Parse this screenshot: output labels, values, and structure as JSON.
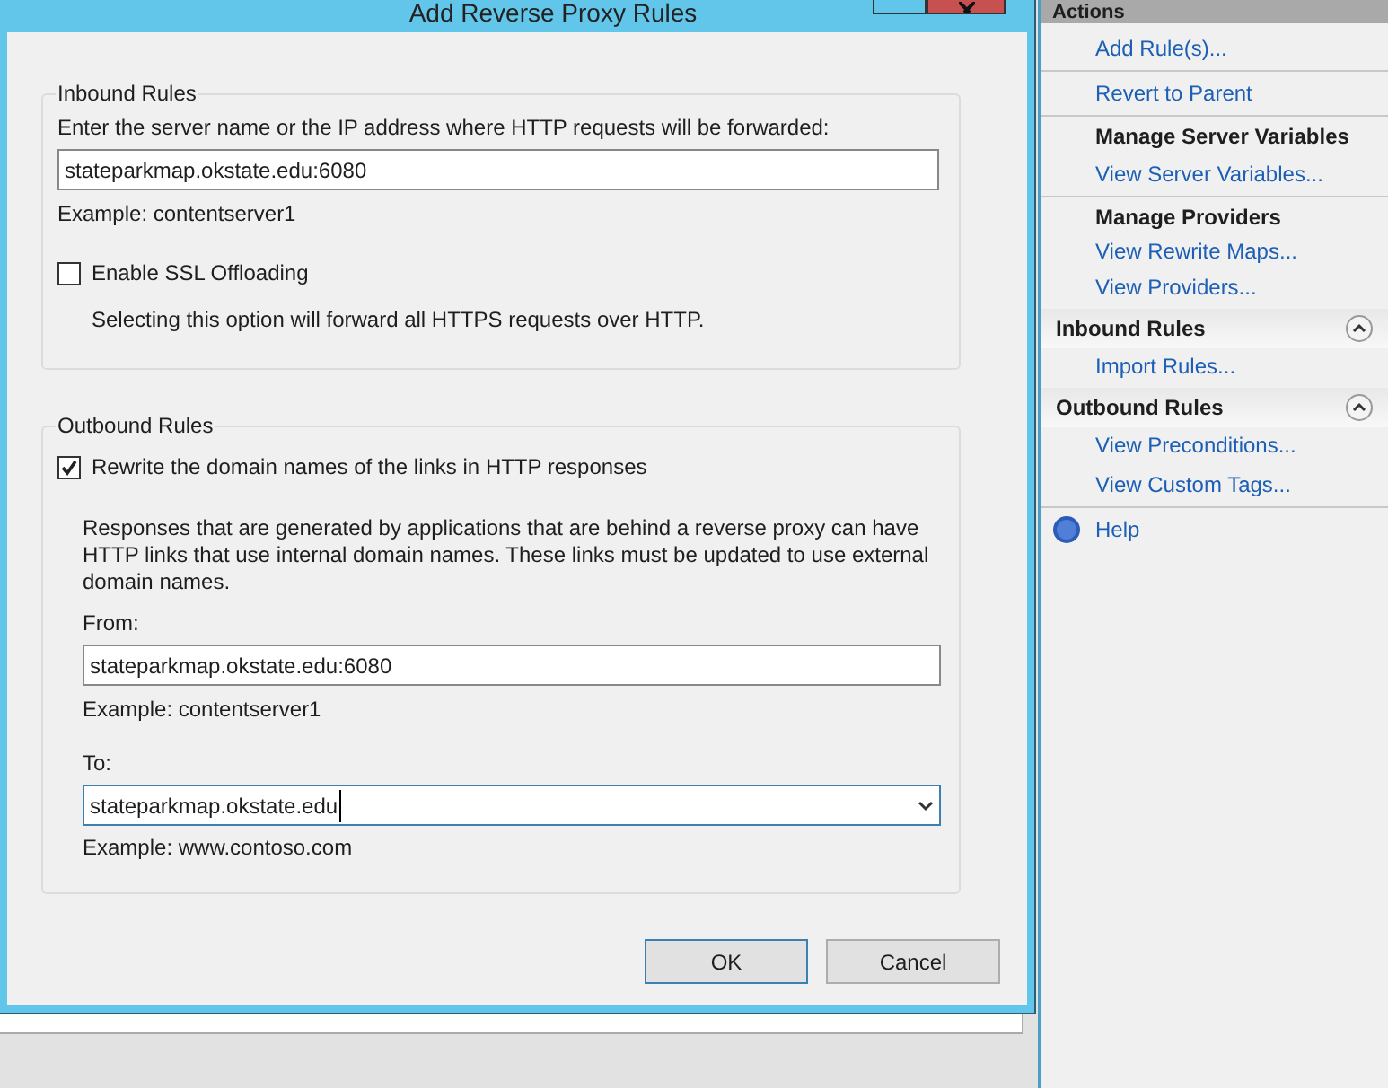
{
  "dialog": {
    "title": "Add Reverse Proxy Rules",
    "inbound": {
      "legend": "Inbound Rules",
      "prompt": "Enter the server name or the IP address where HTTP requests will be forwarded:",
      "value": "stateparkmap.okstate.edu:6080",
      "example": "Example: contentserver1",
      "ssl": {
        "label": "Enable SSL Offloading",
        "checked": false,
        "note": "Selecting this option will forward all HTTPS requests over HTTP."
      }
    },
    "outbound": {
      "legend": "Outbound Rules",
      "rewrite": {
        "label": "Rewrite the domain names of the links in HTTP responses",
        "checked": true
      },
      "description": "Responses that are generated by applications that are behind a reverse proxy can have HTTP links that use internal domain names. These links must be updated to use external domain names.",
      "from_label": "From:",
      "from_value": "stateparkmap.okstate.edu:6080",
      "from_example": "Example: contentserver1",
      "to_label": "To:",
      "to_value": "stateparkmap.okstate.edu",
      "to_example": "Example: www.contoso.com"
    },
    "buttons": [
      {
        "label": "OK",
        "selected": true
      },
      {
        "label": "Cancel",
        "selected": false
      }
    ]
  },
  "actions": {
    "header": "Actions",
    "items": [
      {
        "kind": "link",
        "label": "Add Rule(s)...",
        "divider": true
      },
      {
        "kind": "link",
        "label": "Revert to Parent",
        "divider": true
      },
      {
        "kind": "heading",
        "label": "Manage Server Variables"
      },
      {
        "kind": "link",
        "label": "View Server Variables...",
        "divider": true
      },
      {
        "kind": "heading",
        "label": "Manage Providers"
      },
      {
        "kind": "link",
        "label": "View Rewrite Maps..."
      },
      {
        "kind": "link",
        "label": "View Providers..."
      },
      {
        "kind": "group",
        "label": "Inbound Rules",
        "expanded": true
      },
      {
        "kind": "link",
        "label": "Import Rules..."
      },
      {
        "kind": "group",
        "label": "Outbound Rules",
        "expanded": true
      },
      {
        "kind": "link",
        "label": "View Preconditions..."
      },
      {
        "kind": "link",
        "label": "View Custom Tags...",
        "divider": true
      },
      {
        "kind": "help",
        "label": "Help"
      }
    ]
  }
}
